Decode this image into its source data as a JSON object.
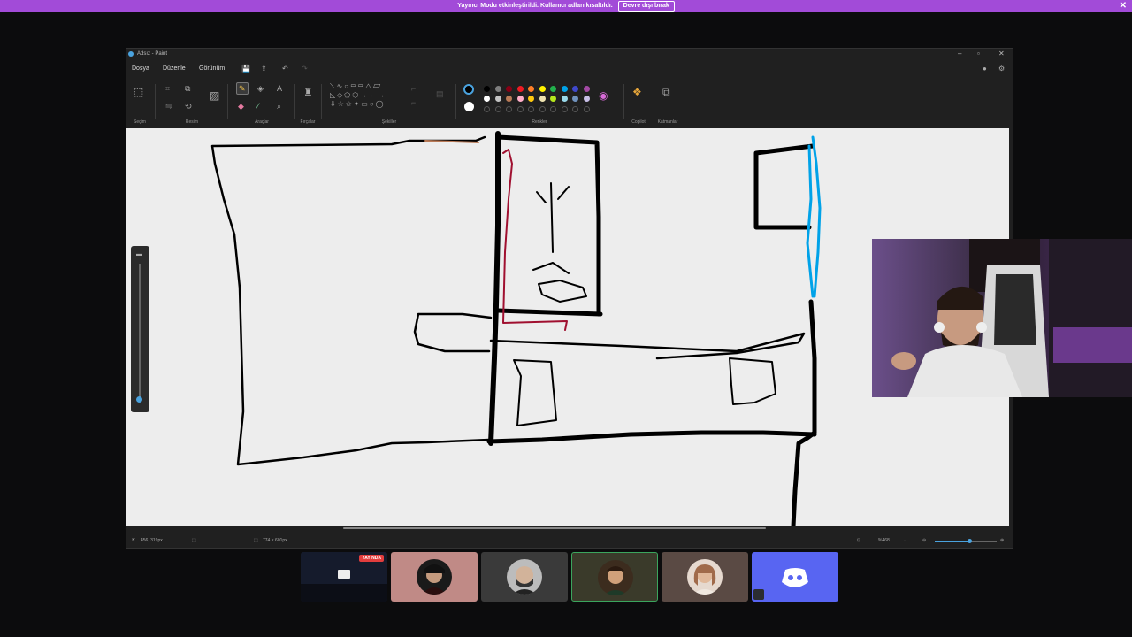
{
  "banner": {
    "text": "Yayıncı Modu etkinleştirildi. Kullanıcı adları kısaltıldı.",
    "button": "Devre dışı bırak",
    "close": "✕"
  },
  "window": {
    "title": "Adsız - Paint",
    "controls": {
      "minimize": "–",
      "maximize": "▫",
      "close": "✕"
    }
  },
  "menu": {
    "file": "Dosya",
    "edit": "Düzenle",
    "view": "Görünüm"
  },
  "ribbon": {
    "groups": {
      "selection": "Seçim",
      "image": "Resim",
      "tools": "Araçlar",
      "brushes": "Fırçalar",
      "shapes": "Şekiller",
      "colors": "Renkler",
      "copilot": "Copilot",
      "layers": "Katmanlar"
    },
    "active_color": "#000000",
    "secondary_color": "#ffffff",
    "palette_row1": [
      "#000000",
      "#7f7f7f",
      "#880015",
      "#ed1c24",
      "#ff7f27",
      "#fff200",
      "#22b14c",
      "#00a2e8",
      "#3f48cc",
      "#a349a4"
    ],
    "palette_row2": [
      "#ffffff",
      "#c3c3c3",
      "#b97a57",
      "#ffaec9",
      "#ffc90e",
      "#efe4b0",
      "#b5e61d",
      "#99d9ea",
      "#7092be",
      "#c8bfe7"
    ]
  },
  "status": {
    "cursor_pos": "456, 319px",
    "canvas_size": "774 × 601px",
    "zoom": "%468",
    "zoom_level": 0.55
  },
  "participants": {
    "live_badge": "YAYINDA"
  }
}
